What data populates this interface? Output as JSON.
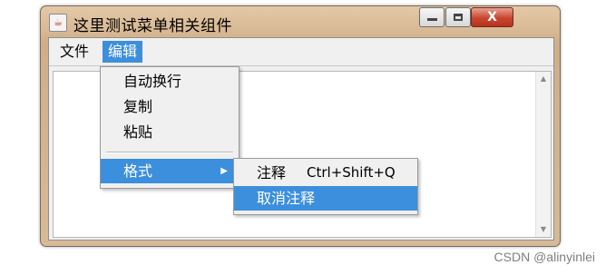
{
  "window": {
    "title": "这里测试菜单相关组件",
    "app_icon": "java-coffee-icon",
    "controls": {
      "minimize_icon": "minimize-icon",
      "maximize_icon": "maximize-icon",
      "close_icon": "close-icon",
      "close_glyph": "X"
    }
  },
  "menubar": {
    "items": [
      {
        "label": "文件"
      },
      {
        "label": "编辑",
        "active": true
      }
    ]
  },
  "edit_menu": {
    "items": [
      {
        "label": "自动换行"
      },
      {
        "label": "复制"
      },
      {
        "label": "粘贴"
      },
      {
        "label": "格式",
        "has_submenu": true,
        "submenu_arrow": "▶"
      }
    ]
  },
  "format_submenu": {
    "items": [
      {
        "label": "注释",
        "accelerator": "Ctrl+Shift+Q"
      },
      {
        "label": "取消注释",
        "highlighted": true
      }
    ]
  },
  "scrollbar": {
    "up_arrow": "▲",
    "down_arrow": "▼"
  },
  "watermark": "CSDN @alinyinlei",
  "colors": {
    "highlight": "#3c8fdc",
    "close_button": "#c7452f",
    "window_frame": "#d8b894"
  }
}
